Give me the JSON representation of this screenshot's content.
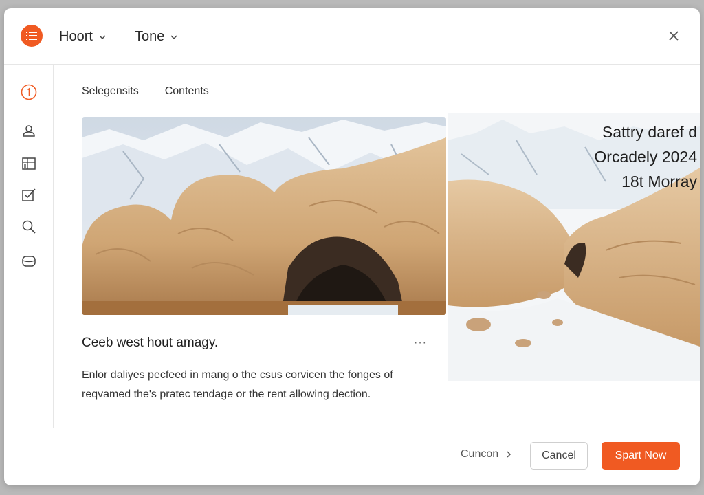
{
  "header": {
    "logo_icon": "list-icon",
    "menu_1": "Hoort",
    "menu_2": "Tone",
    "close_icon": "close-icon"
  },
  "sidebar": {
    "icons": [
      "step-1-icon",
      "user-icon",
      "grid-icon",
      "checkbox-icon",
      "search-icon",
      "storage-icon"
    ]
  },
  "tabs": [
    {
      "label": "Selegensits",
      "active": true
    },
    {
      "label": "Contents",
      "active": false
    }
  ],
  "side_caption": {
    "line1": "Sattry daref d",
    "line2": "Orcadely 2024",
    "line3": "18t Morray"
  },
  "card": {
    "title": "Ceeb west hout amagy.",
    "more": "···",
    "body_line1": "Enlor daliyes pecfeed in mang o the csus corvicen the fonges of",
    "body_line2": "reqvamed the's pratec tendage or the rent allowing dection."
  },
  "footer": {
    "link_label": "Cuncon",
    "cancel_label": "Cancel",
    "primary_label": "Spart Now"
  },
  "colors": {
    "accent": "#f05a22",
    "tab_underline": "#e07a6a"
  }
}
